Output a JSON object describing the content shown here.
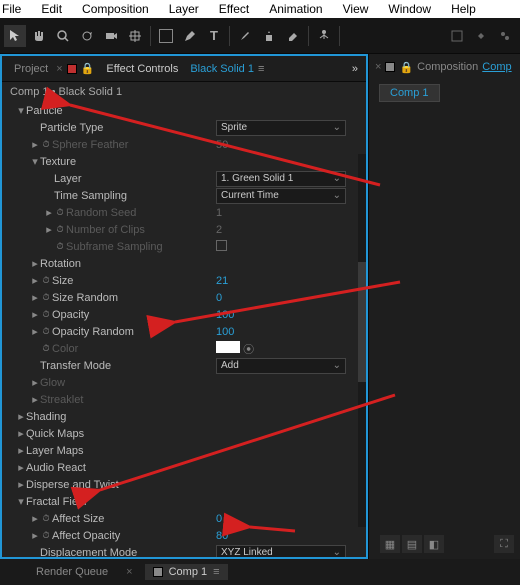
{
  "menu": {
    "items": [
      "File",
      "Edit",
      "Composition",
      "Layer",
      "Effect",
      "Animation",
      "View",
      "Window",
      "Help"
    ]
  },
  "panel_tabs": {
    "project": "Project",
    "effect_controls": "Effect Controls",
    "layer_name": "Black Solid 1"
  },
  "right_panel": {
    "composition": "Composition",
    "comp_name": "Comp",
    "comp_tab": "Comp 1"
  },
  "breadcrumb": "Comp 1 • Black Solid 1",
  "props": {
    "particle": "Particle",
    "particle_type": "Particle Type",
    "particle_type_val": "Sprite",
    "sphere_feather": "Sphere Feather",
    "sphere_feather_val": "50",
    "texture": "Texture",
    "layer": "Layer",
    "layer_val": "1. Green Solid 1",
    "time_sampling": "Time Sampling",
    "time_sampling_val": "Current Time",
    "random_seed": "Random Seed",
    "random_seed_val": "1",
    "num_clips": "Number of Clips",
    "num_clips_val": "2",
    "subframe": "Subframe Sampling",
    "rotation": "Rotation",
    "size": "Size",
    "size_val": "21",
    "size_random": "Size Random",
    "size_random_val": "0",
    "opacity": "Opacity",
    "opacity_val": "100",
    "opacity_random": "Opacity Random",
    "opacity_random_val": "100",
    "color": "Color",
    "transfer_mode": "Transfer Mode",
    "transfer_mode_val": "Add",
    "glow": "Glow",
    "streaklet": "Streaklet",
    "shading": "Shading",
    "quick_maps": "Quick Maps",
    "layer_maps": "Layer Maps",
    "audio_react": "Audio React",
    "disperse": "Disperse and Twist",
    "fractal": "Fractal Field",
    "affect_size": "Affect Size",
    "affect_size_val": "0",
    "affect_opacity": "Affect Opacity",
    "affect_opacity_val": "80",
    "displacement": "Displacement Mode",
    "displacement_val": "XYZ Linked"
  },
  "footer": {
    "render_queue": "Render Queue",
    "comp1": "Comp 1"
  }
}
